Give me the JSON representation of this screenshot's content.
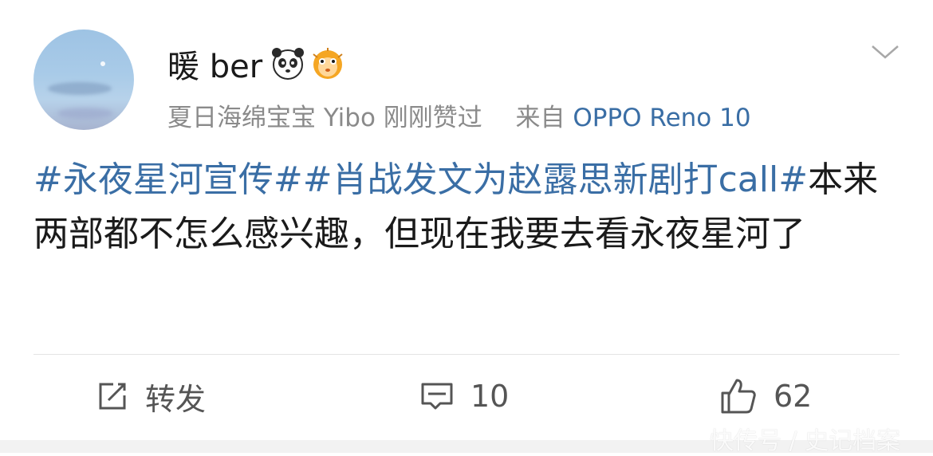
{
  "user": {
    "name": "暖 ber",
    "avatar_icon": "sky-photo-avatar",
    "badges": [
      "panda-emoji",
      "pufferfish-emoji"
    ]
  },
  "meta": {
    "liked_by": "夏日海绵宝宝 Yibo 刚刚赞过",
    "source_prefix": "来自",
    "source_device": "OPPO Reno 10"
  },
  "post": {
    "tag1": "#永夜星河宣传#",
    "tag2": "#肖战发文为赵露思新剧打call#",
    "body": "本来两部都不怎么感兴趣，但现在我要去看永夜星河了"
  },
  "actions": {
    "repost_label": "转发",
    "comment_count": "10",
    "like_count": "62"
  },
  "watermark": "快传号 / 史记档案",
  "colors": {
    "link_blue": "#3a6ea5",
    "meta_gray": "#8a8a8a",
    "text": "#1a1a1a"
  }
}
